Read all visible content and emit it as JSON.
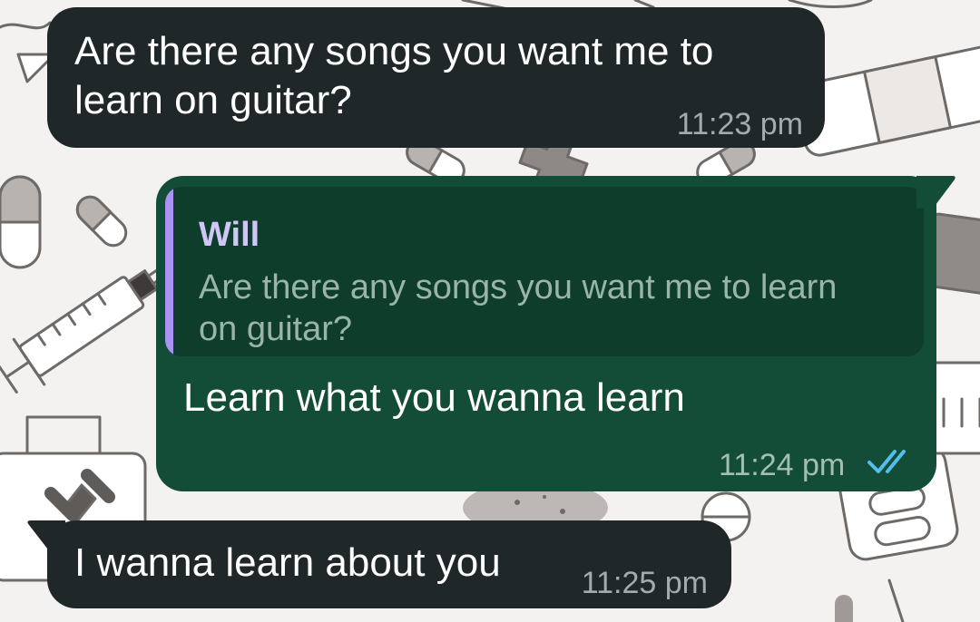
{
  "colors": {
    "incoming_bubble": "#202729",
    "outgoing_bubble": "#134d37",
    "quote_background": "#0f3d2c",
    "quote_bar": "#a993f2",
    "quote_author": "#d0c7f7",
    "read_ticks": "#53bdeb"
  },
  "messages": [
    {
      "direction": "incoming",
      "text": "Are there any songs you want me to\nlearn on guitar?",
      "time": "11:23 pm"
    },
    {
      "direction": "outgoing",
      "reply_to": {
        "author": "Will",
        "text": "Are there any songs you want me to learn\non guitar?"
      },
      "text": "Learn what you wanna learn",
      "time": "11:24 pm",
      "status_icon": "double-check-read-icon"
    },
    {
      "direction": "incoming",
      "text": "I wanna learn about you",
      "time": "11:25 pm"
    }
  ]
}
